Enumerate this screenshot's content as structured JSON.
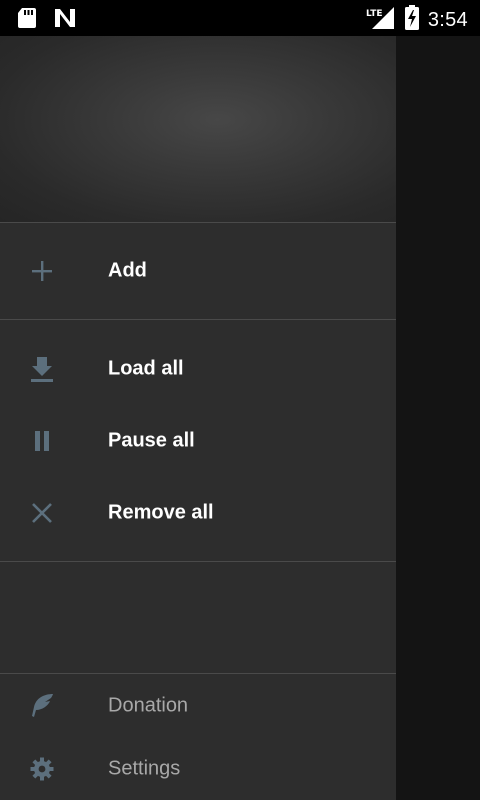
{
  "status_bar": {
    "time": "3:54",
    "network": "LTE",
    "icons": [
      "sd-card-icon",
      "n-notification-icon",
      "lte-signal-icon",
      "battery-charging-icon"
    ]
  },
  "drawer": {
    "section_add": [
      {
        "label": "Add",
        "icon": "plus-icon"
      }
    ],
    "section_bulk": [
      {
        "label": "Load all",
        "icon": "download-icon"
      },
      {
        "label": "Pause all",
        "icon": "pause-icon"
      },
      {
        "label": "Remove all",
        "icon": "close-icon"
      }
    ],
    "section_footer": [
      {
        "label": "Donation",
        "icon": "feather-icon"
      },
      {
        "label": "Settings",
        "icon": "gear-icon"
      }
    ]
  },
  "colors": {
    "drawer_bg": "#2d2d2d",
    "icon": "#5c6f7d",
    "label": "#ffffff",
    "label_dim": "#a8a8a8",
    "divider": "#4a4a4a"
  }
}
